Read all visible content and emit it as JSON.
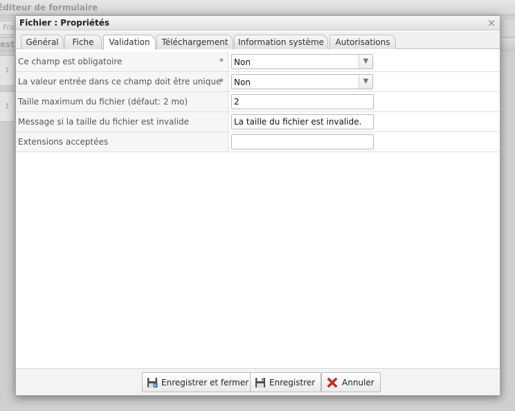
{
  "background": {
    "app_title": "Éditeur de formulaire",
    "tab_fragment": "Fra",
    "header_fragment": "est"
  },
  "dialog": {
    "title": "Fichier : Propriétés",
    "close_symbol": "×",
    "tabs": [
      {
        "label": "Général"
      },
      {
        "label": "Fiche"
      },
      {
        "label": "Validation",
        "active": true
      },
      {
        "label": "Téléchargement"
      },
      {
        "label": "Information système"
      },
      {
        "label": "Autorisations"
      }
    ],
    "fields": [
      {
        "label": "Ce champ est obligatoire",
        "required_mark": "*",
        "type": "combo",
        "value": "Non"
      },
      {
        "label": "La valeur entrée dans ce champ doit être unique",
        "required_mark": "*",
        "type": "combo",
        "value": "Non"
      },
      {
        "label": "Taille maximum du fichier (défaut: 2 mo)",
        "type": "text",
        "value": "2"
      },
      {
        "label": "Message si la taille du fichier est invalide",
        "type": "text",
        "value": "La taille du fichier est invalide."
      },
      {
        "label": "Extensions acceptées",
        "type": "text",
        "value": ""
      }
    ],
    "buttons": {
      "save_close": "Enregistrer et fermer",
      "save": "Enregistrer",
      "cancel": "Annuler"
    }
  },
  "colors": {
    "cancel_icon": "#d42a1e",
    "save_icon": "#4a4a4a"
  }
}
